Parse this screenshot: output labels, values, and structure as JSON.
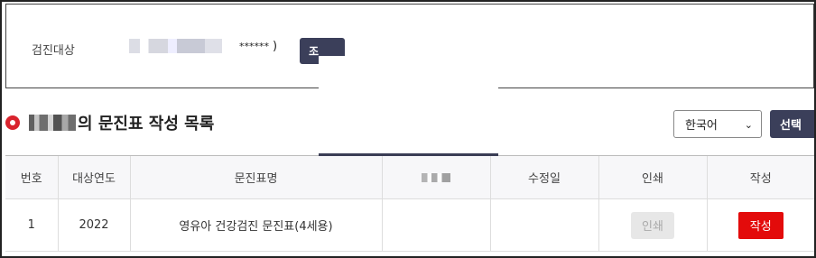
{
  "search": {
    "label": "검진대상",
    "masked_value": "******",
    "close_paren": ")",
    "button_label": "조"
  },
  "header": {
    "title_suffix": "의 문진표 작성 목록",
    "language_select": {
      "selected": "한국어",
      "options": [
        "한국어"
      ]
    },
    "select_button_label": "선택"
  },
  "table": {
    "columns": [
      "번호",
      "대상연도",
      "문진표명",
      "",
      "수정일",
      "인쇄",
      "작성"
    ],
    "rows": [
      {
        "no": "1",
        "year": "2022",
        "name": "영유아 건강검진 문진표(4세용)",
        "hidden": "",
        "modified": "",
        "print_label": "인쇄",
        "write_label": "작성"
      }
    ]
  },
  "colors": {
    "accent_dark": "#3b3f5a",
    "danger": "#e30b0b",
    "pin": "#d9232d"
  },
  "icons": [
    "location-pin-icon",
    "chevron-down-icon"
  ]
}
